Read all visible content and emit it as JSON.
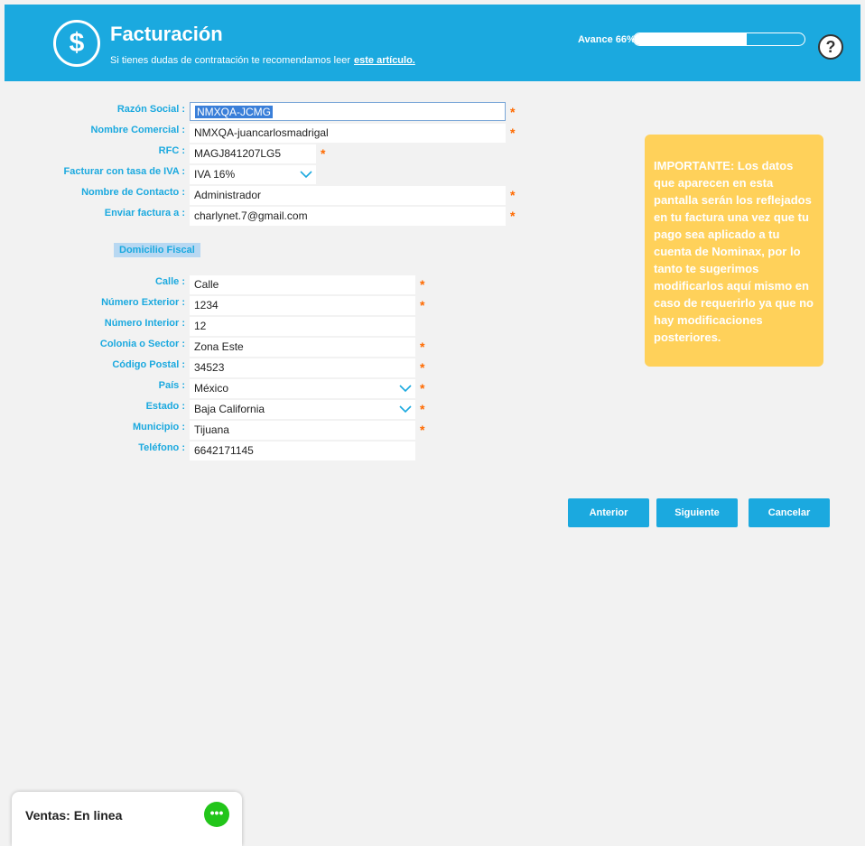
{
  "header": {
    "icon": "dollar-icon",
    "icon_glyph": "$",
    "title": "Facturación",
    "subtitle": "Si tienes dudas de contratación te recomendamos leer",
    "link": "este artículo.",
    "progress_label": "Avance 66%",
    "progress_value": 0.66,
    "help_glyph": "?"
  },
  "form": {
    "razon_social": {
      "label": "Razón Social :",
      "value": "NMXQA-JCMG"
    },
    "nombre_comercial": {
      "label": "Nombre Comercial :",
      "value": "NMXQA-juancarlosmadrigal"
    },
    "rfc": {
      "label": "RFC :",
      "value": "MAGJ841207LG5"
    },
    "iva": {
      "label": "Facturar con tasa de IVA :",
      "value": "IVA 16%"
    },
    "contacto": {
      "label": "Nombre de Contacto :",
      "value": "Administrador"
    },
    "email": {
      "label": "Enviar factura a :",
      "value": "charlynet.7@gmail.com"
    }
  },
  "domicilio": {
    "section_title": "Domicilio Fiscal",
    "calle": {
      "label": "Calle :",
      "value": "Calle"
    },
    "num_ext": {
      "label": "Número Exterior :",
      "value": "1234"
    },
    "num_int": {
      "label": "Número Interior :",
      "value": "12"
    },
    "colonia": {
      "label": "Colonia o Sector :",
      "value": "Zona Este"
    },
    "cp": {
      "label": "Código Postal :",
      "value": "34523"
    },
    "pais": {
      "label": "País :",
      "value": "México"
    },
    "estado": {
      "label": "Estado :",
      "value": "Baja California"
    },
    "municipio": {
      "label": "Municipio :",
      "value": "Tijuana"
    },
    "telefono": {
      "label": "Teléfono :",
      "value": "6642171145"
    }
  },
  "required_mark": "*",
  "notice": "IMPORTANTE: Los datos que aparecen en esta pantalla serán los reflejados en tu factura una vez que tu pago sea aplicado a tu cuenta de Nominax, por lo tanto te sugerimos modificarlos aquí mismo en caso de requerirlo ya que no hay modificaciones posteriores.",
  "buttons": {
    "prev": "Anterior",
    "next": "Siguiente",
    "cancel": "Cancelar"
  },
  "chat": {
    "label": "Ventas: En linea",
    "icon": "chat-bubble-icon",
    "icon_glyph": "•••"
  },
  "colors": {
    "accent": "#1ba9df",
    "required": "#ff6a00",
    "notice": "#ffd15a",
    "chat": "#22c51a"
  }
}
